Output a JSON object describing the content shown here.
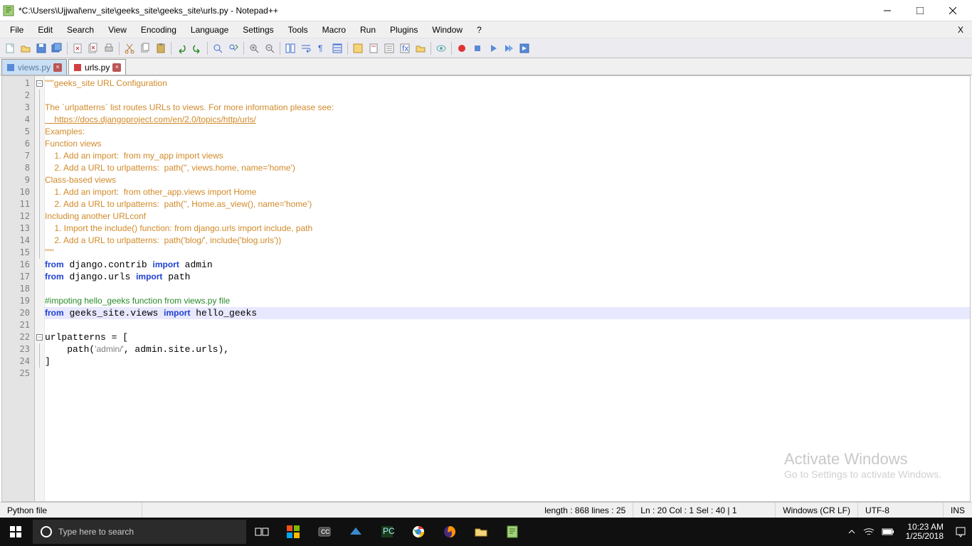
{
  "window": {
    "title": "*C:\\Users\\Ujjwal\\env_site\\geeks_site\\geeks_site\\urls.py - Notepad++"
  },
  "menus": [
    "File",
    "Edit",
    "Search",
    "View",
    "Encoding",
    "Language",
    "Settings",
    "Tools",
    "Macro",
    "Run",
    "Plugins",
    "Window",
    "?"
  ],
  "menubar_right_x": "X",
  "tabs": [
    {
      "label": "views.py",
      "active": false
    },
    {
      "label": "urls.py",
      "active": true
    }
  ],
  "code_lines": [
    {
      "n": 1,
      "type": "str",
      "text": "\"\"\"geeks_site URL Configuration",
      "fold": "minus"
    },
    {
      "n": 2,
      "type": "str",
      "text": ""
    },
    {
      "n": 3,
      "type": "str",
      "text": "The `urlpatterns` list routes URLs to views. For more information please see:"
    },
    {
      "n": 4,
      "type": "link",
      "text": "    https://docs.djangoproject.com/en/2.0/topics/http/urls/"
    },
    {
      "n": 5,
      "type": "str",
      "text": "Examples:"
    },
    {
      "n": 6,
      "type": "str",
      "text": "Function views"
    },
    {
      "n": 7,
      "type": "str",
      "text": "    1. Add an import:  from my_app import views"
    },
    {
      "n": 8,
      "type": "str",
      "text": "    2. Add a URL to urlpatterns:  path('', views.home, name='home')"
    },
    {
      "n": 9,
      "type": "str",
      "text": "Class-based views"
    },
    {
      "n": 10,
      "type": "str",
      "text": "    1. Add an import:  from other_app.views import Home"
    },
    {
      "n": 11,
      "type": "str",
      "text": "    2. Add a URL to urlpatterns:  path('', Home.as_view(), name='home')"
    },
    {
      "n": 12,
      "type": "str",
      "text": "Including another URLconf"
    },
    {
      "n": 13,
      "type": "str",
      "text": "    1. Import the include() function: from django.urls import include, path"
    },
    {
      "n": 14,
      "type": "str",
      "text": "    2. Add a URL to urlpatterns:  path('blog/', include('blog.urls'))"
    },
    {
      "n": 15,
      "type": "str",
      "text": "\"\"\""
    },
    {
      "n": 16,
      "type": "code",
      "html": "<span class='k'>from</span> django.contrib <span class='k'>import</span> admin"
    },
    {
      "n": 17,
      "type": "code",
      "html": "<span class='k'>from</span> django.urls <span class='k'>import</span> path"
    },
    {
      "n": 18,
      "type": "code",
      "html": ""
    },
    {
      "n": 19,
      "type": "comment",
      "text": "#impoting hello_geeks function from views.py file"
    },
    {
      "n": 20,
      "type": "code",
      "html": "<span class='k'>from</span> geeks_site.views <span class='k'>import</span> hello_geeks",
      "highlight": true
    },
    {
      "n": 21,
      "type": "code",
      "html": ""
    },
    {
      "n": 22,
      "type": "code",
      "html": "urlpatterns = [",
      "fold": "minus"
    },
    {
      "n": 23,
      "type": "code",
      "html": "    path(<span class='q'>'admin/'</span>, admin.site.urls),"
    },
    {
      "n": 24,
      "type": "code",
      "html": "]"
    },
    {
      "n": 25,
      "type": "code",
      "html": ""
    }
  ],
  "watermark": {
    "title": "Activate Windows",
    "sub": "Go to Settings to activate Windows."
  },
  "status": {
    "type": "Python file",
    "length": "length : 868    lines : 25",
    "pos": "Ln : 20    Col : 1    Sel : 40 | 1",
    "eol": "Windows (CR LF)",
    "enc": "UTF-8",
    "ins": "INS"
  },
  "taskbar": {
    "search_placeholder": "Type here to search",
    "clock_time": "10:23 AM",
    "clock_date": "1/25/2018"
  }
}
